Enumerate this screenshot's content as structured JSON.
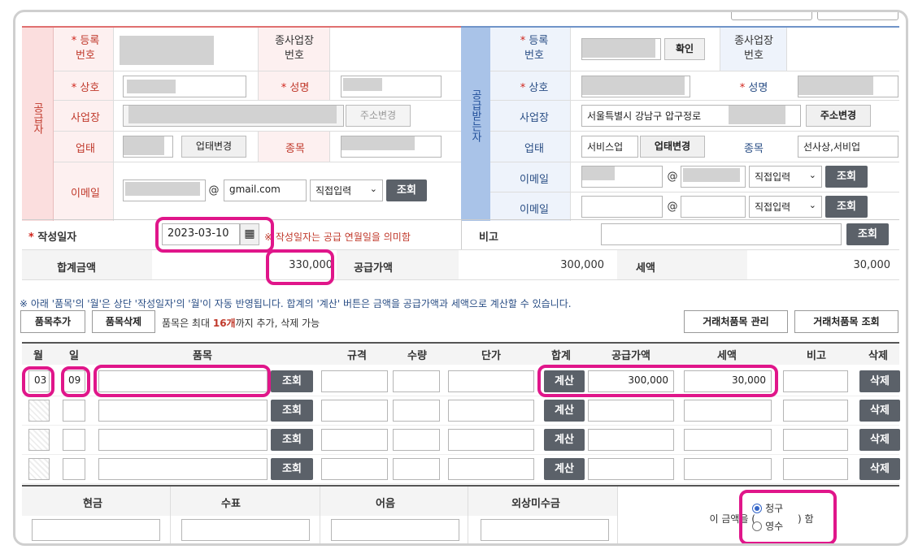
{
  "supplier": {
    "side_label": "공급자",
    "reg_no_label": "등록\n번호",
    "branch_label": "종사업장\n번호",
    "company_label": "상호",
    "ceo_label": "성명",
    "address_label": "사업장",
    "address_change_btn": "주소변경",
    "biztype_label": "업태",
    "biztype_change_btn": "업태변경",
    "item_label": "종목",
    "email_label": "이메일",
    "email_at": "@",
    "email_domain": "gmail.com",
    "email_select": "직접입력",
    "lookup_btn": "조회"
  },
  "receiver": {
    "side_label": "공급받는자",
    "reg_no_label": "등록\n번호",
    "confirm_btn": "확인",
    "branch_label": "종사업장\n번호",
    "company_label": "상호",
    "ceo_label": "성명",
    "address_label": "사업장",
    "address_value": "서울특별시 강남구 압구정로",
    "address_change_btn": "주소변경",
    "biztype_label": "업태",
    "biztype_value": "서비스업",
    "biztype_change_btn": "업태변경",
    "item_label": "종목",
    "item_value": "선사상,서비업",
    "email_label": "이메일",
    "email_at": "@",
    "email_select": "직접입력",
    "lookup_btn": "조회",
    "email2_label": "이메일",
    "email2_at": "@",
    "email2_select": "직접입력",
    "lookup2_btn": "조회"
  },
  "invoice": {
    "date_label": "작성일자",
    "date_value": "2023-03-10",
    "date_note": "※ 작성일자는 공급 연월일을 의미함",
    "memo_label": "비고",
    "memo_lookup_btn": "조회",
    "total_label": "합계금액",
    "total_value": "330,000",
    "supply_label": "공급가액",
    "supply_value": "300,000",
    "tax_label": "세액",
    "tax_value": "30,000"
  },
  "items_section": {
    "notice": "※ 아래 '품목'의 '월'은 상단 '작성일자'의 '월'이 자동 반영됩니다. 합계의 '계산' 버튼은 금액을 공급가액과 세액으로 계산할 수 있습니다.",
    "add_btn": "품목추가",
    "delete_btn": "품목삭제",
    "max_text_pre": "품목은 최대",
    "max_count": "16개",
    "max_text_post": "까지 추가, 삭제 가능",
    "partner_manage_btn": "거래처품목 관리",
    "partner_lookup_btn": "거래처품목 조회",
    "headers": [
      "월",
      "일",
      "품목",
      "규격",
      "수량",
      "단가",
      "합계",
      "공급가액",
      "세액",
      "비고",
      "삭제"
    ],
    "lookup_btn": "조회",
    "calc_btn": "계산",
    "del_btn": "삭제",
    "rows": [
      {
        "month": "03",
        "day": "09",
        "supply": "300,000",
        "tax": "30,000"
      },
      {
        "month": "",
        "day": "",
        "supply": "",
        "tax": ""
      },
      {
        "month": "",
        "day": "",
        "supply": "",
        "tax": ""
      },
      {
        "month": "",
        "day": "",
        "supply": "",
        "tax": ""
      }
    ]
  },
  "payment": {
    "headers": [
      "현금",
      "수표",
      "어음",
      "외상미수금"
    ],
    "amount_text_pre": "이 금액을 (",
    "amount_text_post": ") 함",
    "radio_claim": "청구",
    "radio_receipt": "영수",
    "selected": "청구"
  },
  "colors": {
    "supplier_bg": "#fdf0f0",
    "receiver_bg": "#eef3fb",
    "receiver_side": "#a9c3e8",
    "highlight": "#e0168a",
    "dark_button": "#5b6169"
  }
}
